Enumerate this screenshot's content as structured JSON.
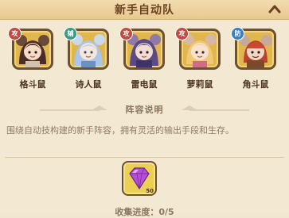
{
  "header": {
    "title": "新手自动队"
  },
  "members": [
    {
      "name": "格斗鼠",
      "role": "攻",
      "role_color": "#c24840"
    },
    {
      "name": "诗人鼠",
      "role": "辅",
      "role_color": "#3a9a84"
    },
    {
      "name": "雷电鼠",
      "role": "攻",
      "role_color": "#c24840"
    },
    {
      "name": "萝莉鼠",
      "role": "攻",
      "role_color": "#c24840"
    },
    {
      "name": "角斗鼠",
      "role": "防",
      "role_color": "#3a7fbf"
    }
  ],
  "section": {
    "title": "阵容说明",
    "description": "围绕自动技构建的新手阵容，拥有灵活的输出手段和生存。"
  },
  "reward": {
    "icon": "purple-gem-icon",
    "count": "50"
  },
  "progress": {
    "label": "收集进度：0/5"
  },
  "colors": {
    "header_bg": "#ecd19b",
    "panel_bg": "#f3e8d2",
    "text_brown": "#6b4323"
  }
}
